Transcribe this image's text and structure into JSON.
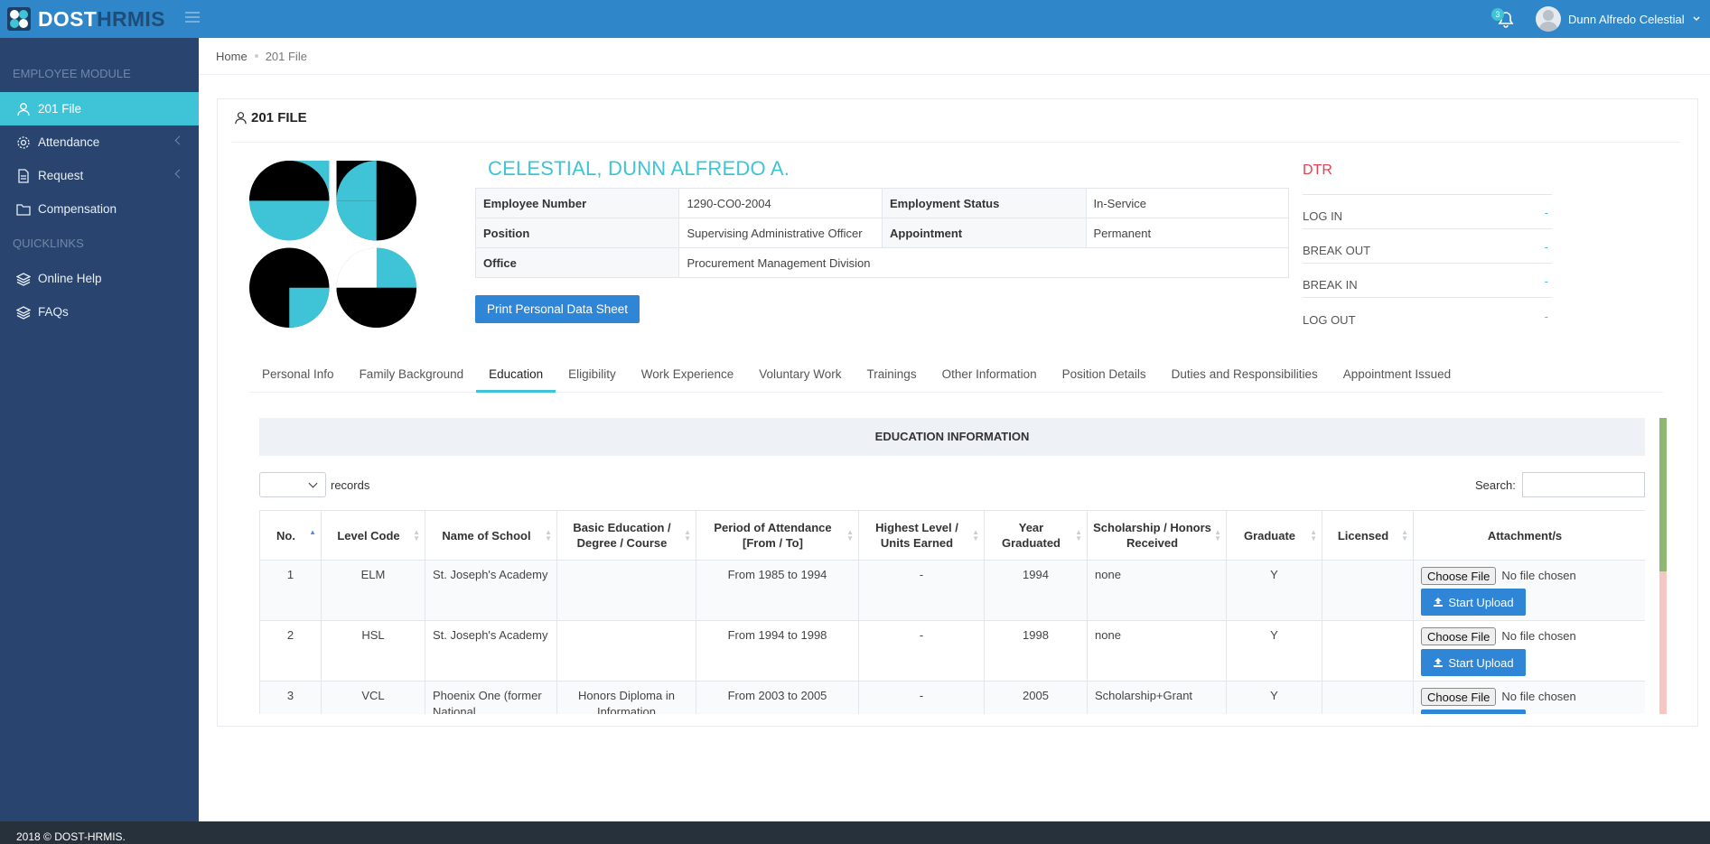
{
  "app": {
    "brand_part1": "DOST",
    "brand_part2": "HRMIS",
    "notification_count": "3",
    "user_name": "Dunn Alfredo Celestial"
  },
  "sidebar": {
    "heading_employee": "EMPLOYEE MODULE",
    "heading_quicklinks": "QUICKLINKS",
    "items": [
      {
        "label": "201 File",
        "icon": "user-icon",
        "active": true
      },
      {
        "label": "Attendance",
        "icon": "gear-icon"
      },
      {
        "label": "Request",
        "icon": "document-icon"
      },
      {
        "label": "Compensation",
        "icon": "folder-icon"
      },
      {
        "label": "Online Help",
        "icon": "layers-icon"
      },
      {
        "label": "FAQs",
        "icon": "layers-icon"
      }
    ]
  },
  "breadcrumb": [
    "Home",
    "201 File"
  ],
  "page": {
    "title": "201 FILE",
    "employee_name": "CELESTIAL, DUNN ALFREDO A.",
    "info": {
      "employee_number_label": "Employee Number",
      "employee_number": "1290-CO0-2004",
      "employment_status_label": "Employment Status",
      "employment_status": "In-Service",
      "position_label": "Position",
      "position": "Supervising Administrative Officer",
      "appointment_label": "Appointment",
      "appointment": "Permanent",
      "office_label": "Office",
      "office": "Procurement Management Division"
    },
    "print_button": "Print Personal Data Sheet",
    "dtr": {
      "title": "DTR",
      "rows": [
        {
          "label": "LOG IN",
          "value": "-"
        },
        {
          "label": "BREAK OUT",
          "value": "-"
        },
        {
          "label": "BREAK IN",
          "value": "-"
        },
        {
          "label": "LOG OUT",
          "value": "-"
        }
      ]
    }
  },
  "tabs": [
    "Personal Info",
    "Family Background",
    "Education",
    "Eligibility",
    "Work Experience",
    "Voluntary Work",
    "Trainings",
    "Other Information",
    "Position Details",
    "Duties and Responsibilities",
    "Appointment Issued"
  ],
  "education": {
    "heading": "EDUCATION INFORMATION",
    "records_label": "records",
    "search_label": "Search:",
    "columns": [
      "No.",
      "Level Code",
      "Name of School",
      "Basic Education / Degree / Course",
      "Period of Attendance [From / To]",
      "Highest Level / Units Earned",
      "Year Graduated",
      "Scholarship / Honors Received",
      "Graduate",
      "Licensed",
      "Attachment/s"
    ],
    "choose_file": "Choose File",
    "no_file": "No file chosen",
    "upload_label": "Start Upload",
    "rows": [
      {
        "no": "1",
        "level": "ELM",
        "school": "St. Joseph's Academy",
        "course": "",
        "period": "From 1985 to 1994",
        "units": "-",
        "year": "1994",
        "honors": "none",
        "graduate": "Y",
        "licensed": ""
      },
      {
        "no": "2",
        "level": "HSL",
        "school": "St. Joseph's Academy",
        "course": "",
        "period": "From 1994 to 1998",
        "units": "-",
        "year": "1998",
        "honors": "none",
        "graduate": "Y",
        "licensed": ""
      },
      {
        "no": "3",
        "level": "VCL",
        "school": "Phoenix One (former National",
        "course": "Honors Diploma in Information",
        "period": "From 2003 to 2005",
        "units": "-",
        "year": "2005",
        "honors": "Scholarship+Grant",
        "graduate": "Y",
        "licensed": ""
      }
    ]
  },
  "footer": "2018 © DOST-HRMIS."
}
